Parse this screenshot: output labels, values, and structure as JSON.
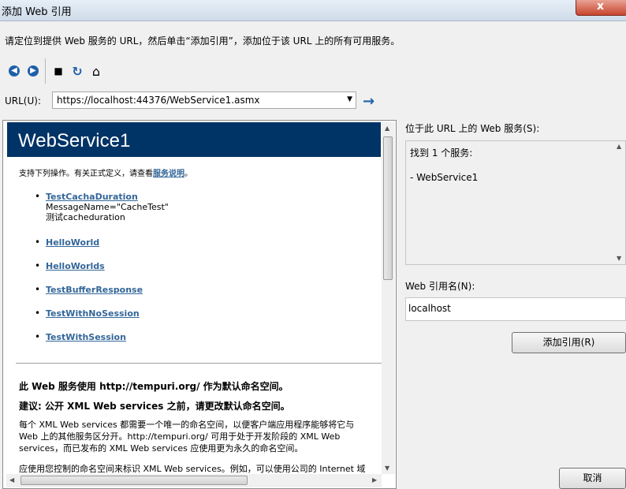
{
  "window": {
    "title": "添加 Web 引用",
    "close_label": "x"
  },
  "instruction": "请定位到提供 Web 服务的 URL，然后单击“添加引用”，添加位于该 URL 上的所有可用服务。",
  "toolbar": {
    "back_icon": "back-arrow-icon",
    "forward_icon": "forward-arrow-icon",
    "stop_glyph": "■",
    "refresh_glyph": "↻",
    "home_glyph": "⌂"
  },
  "url": {
    "label": "URL(U):",
    "value": "https://localhost:44376/WebService1.asmx",
    "go_glyph": "→"
  },
  "browser": {
    "service_title": "WebService1",
    "support_text": "支持下列操作。有关正式定义，请查看",
    "support_link": "服务说明",
    "support_end": "。",
    "operations": [
      {
        "name": "TestCachaDuration",
        "sub1": "MessageName=\"CacheTest\"",
        "sub2": "测试cacheduration"
      },
      {
        "name": "HelloWorld"
      },
      {
        "name": "HelloWorlds"
      },
      {
        "name": "TestBufferResponse"
      },
      {
        "name": "TestWithNoSession"
      },
      {
        "name": "TestWithSession"
      }
    ],
    "heading1": "此 Web 服务使用 http://tempuri.org/ 作为默认命名空间。",
    "heading2": "建议: 公开 XML Web services 之前，请更改默认命名空间。",
    "para1": "每个 XML Web services 都需要一个唯一的命名空间，以便客户端应用程序能够将它与 Web 上的其他服务区分开。http://tempuri.org/ 可用于处于开发阶段的 XML Web services，而已发布的 XML Web services 应使用更为永久的命名空间。",
    "para2": "应使用您控制的命名空间来标识 XML Web services。例如，可以使用公司的 Internet 域"
  },
  "services_panel": {
    "label": "位于此 URL 上的 Web 服务(S):",
    "found": "找到 1 个服务:",
    "item": "- WebService1"
  },
  "reference": {
    "label": "Web 引用名(N):",
    "value": "localhost"
  },
  "buttons": {
    "add_reference": "添加引用(R)",
    "cancel": "取消"
  }
}
